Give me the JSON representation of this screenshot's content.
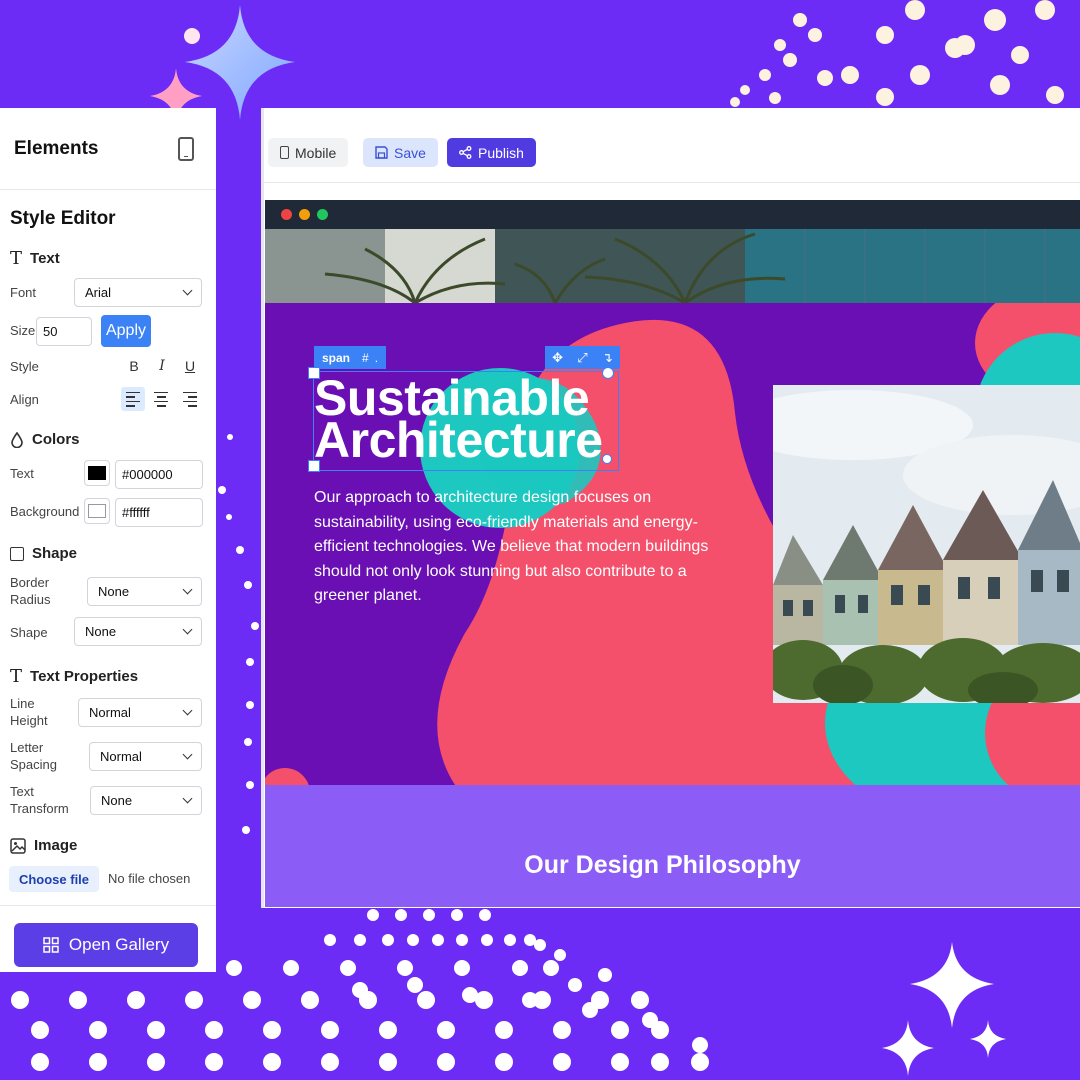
{
  "panel": {
    "title": "Elements",
    "style_editor": "Style Editor",
    "text_section": "Text",
    "font_label": "Font",
    "font_value": "Arial",
    "size_label": "Size",
    "size_value": "50",
    "apply_label": "Apply",
    "style_label": "Style",
    "bold": "B",
    "italic": "I",
    "underline": "U",
    "align_label": "Align",
    "colors_section": "Colors",
    "text_color_label": "Text",
    "text_color_value": "#000000",
    "bg_color_label": "Background",
    "bg_color_value": "#ffffff",
    "shape_section": "Shape",
    "border_radius_label": "Border Radius",
    "border_radius_value": "None",
    "shape_label": "Shape",
    "shape_value": "None",
    "text_props_section": "Text Properties",
    "line_height_label": "Line Height",
    "line_height_value": "Normal",
    "letter_spacing_label": "Letter Spacing",
    "letter_spacing_value": "Normal",
    "text_transform_label": "Text Transform",
    "text_transform_value": "None",
    "image_section": "Image",
    "choose_file": "Choose file",
    "no_file": "No file chosen",
    "open_gallery": "Open Gallery"
  },
  "toolbar": {
    "mobile": "Mobile",
    "save": "Save",
    "publish": "Publish"
  },
  "page": {
    "selection_tag": "span",
    "selection_hash": "#",
    "selection_dot": ".",
    "title_line1": "Sustainable",
    "title_line2": "Architecture",
    "description": "Our approach to architecture design focuses on sustainability, using eco-friendly materials and energy-efficient technologies. We believe that modern buildings should not only look stunning but also contribute to a greener planet.",
    "philosophy": "Our Design Philosophy"
  },
  "colors": {
    "background": "#6c2cf5",
    "accent": "#5b3ee6",
    "hero": "#6a0fb3",
    "blob_coral": "#f4506b",
    "blob_teal": "#1cc8c0",
    "section": "#8b5cf6",
    "selection": "#3b82f6"
  }
}
